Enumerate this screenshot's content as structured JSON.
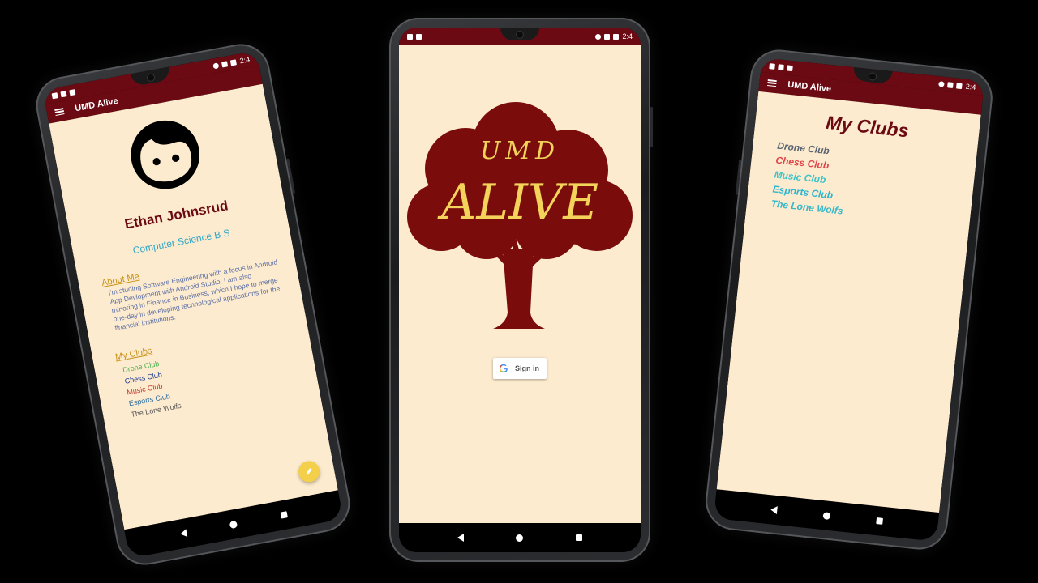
{
  "app": {
    "title": "UMD Alive"
  },
  "status": {
    "time": "2:4"
  },
  "profile": {
    "name": "Ethan Johnsrud",
    "major": "Computer Science B S",
    "about_heading": "About Me",
    "about_text": "I'm studing Software Engineering with a focus in Android App Devlopment with Android Studio.  I am also minoring in Finance in Business, which I hope to merge one-day in developing technological applications for the financial institutions.",
    "clubs_heading": "My Clubs",
    "clubs": [
      {
        "label": "Drone Club",
        "color": "#4caf50"
      },
      {
        "label": "Chess Club",
        "color": "#1f3b8f"
      },
      {
        "label": "Music Club",
        "color": "#c0392b"
      },
      {
        "label": "Esports Club",
        "color": "#2f6f9f"
      },
      {
        "label": "The Lone Wolfs",
        "color": "#555555"
      }
    ]
  },
  "login": {
    "logo_top": "UMD",
    "logo_main": "ALIVE",
    "sign_in_label": "Sign in"
  },
  "my_clubs_screen": {
    "title": "My Clubs",
    "clubs": [
      {
        "label": "Drone Club",
        "color": "#5b6472"
      },
      {
        "label": "Chess Club",
        "color": "#e0474c"
      },
      {
        "label": "Music Club",
        "color": "#3cc4c8"
      },
      {
        "label": "Esports Club",
        "color": "#2bb5cf"
      },
      {
        "label": "The Lone Wolfs",
        "color": "#35b8c9"
      }
    ]
  },
  "colors": {
    "primary": "#6c0a14",
    "background": "#fdebcf",
    "accent": "#f4cf4a",
    "logo_text": "#f3d35a"
  },
  "icons": {
    "menu": "hamburger-icon",
    "edit": "pencil-icon",
    "google": "google-g-icon",
    "avatar": "face-icon"
  }
}
